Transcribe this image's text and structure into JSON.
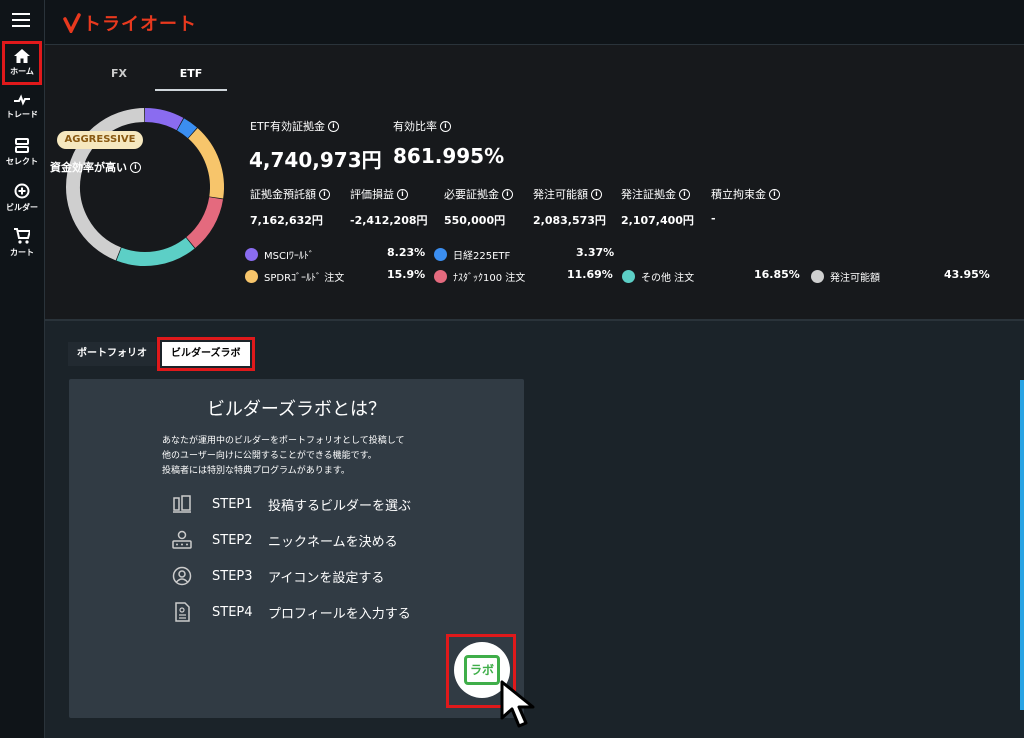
{
  "app": {
    "logo_text": "トライオート",
    "brand_color": "#e8391e"
  },
  "sidebar": {
    "items": [
      {
        "label": "ホーム",
        "icon": "home-icon"
      },
      {
        "label": "トレード",
        "icon": "trade-icon"
      },
      {
        "label": "セレクト",
        "icon": "select-icon"
      },
      {
        "label": "ビルダー",
        "icon": "plus-circle-icon"
      },
      {
        "label": "カート",
        "icon": "cart-icon"
      }
    ]
  },
  "tabs": [
    {
      "label": "FX"
    },
    {
      "label": "ETF"
    }
  ],
  "summary": {
    "badge": "AGGRESSIVE",
    "capital_efficiency": "資金効率が高い",
    "etf_margin_label": "ETF有効証拠金",
    "etf_margin_value": "4,740,973円",
    "ratio_label": "有効比率",
    "ratio_value": "861.995%",
    "metrics": [
      {
        "label": "証拠金預託額",
        "value": "7,162,632円"
      },
      {
        "label": "評価損益",
        "value": "-2,412,208円"
      },
      {
        "label": "必要証拠金",
        "value": "550,000円"
      },
      {
        "label": "発注可能額",
        "value": "2,083,573円"
      },
      {
        "label": "発注証拠金",
        "value": "2,107,400円"
      },
      {
        "label": "積立拘束金",
        "value": "-"
      }
    ]
  },
  "allocation": [
    {
      "name": "MSCIﾜｰﾙﾄﾞ",
      "pct": "8.23%",
      "value": 8.23,
      "color": "#8a6cf0"
    },
    {
      "name": "日経225ETF",
      "pct": "3.37%",
      "value": 3.37,
      "color": "#3b8ef0"
    },
    {
      "name": "SPDRｺﾞｰﾙﾄﾞ 注文",
      "pct": "15.9%",
      "value": 15.9,
      "color": "#f7c56b"
    },
    {
      "name": "ﾅｽﾀﾞｯｸ100 注文",
      "pct": "11.69%",
      "value": 11.69,
      "color": "#e46a7e"
    },
    {
      "name": "その他 注文",
      "pct": "16.85%",
      "value": 16.85,
      "color": "#5ccfc6"
    },
    {
      "name": "発注可能額",
      "pct": "43.95%",
      "value": 43.95,
      "color": "#cfcfcf"
    }
  ],
  "subtabs": [
    {
      "label": "ポートフォリオ"
    },
    {
      "label": "ビルダーズラボ"
    }
  ],
  "card": {
    "title": "ビルダーズラボとは？",
    "desc_lines": [
      "あなたが運用中のビルダーをポートフォリオとして投稿して",
      "他のユーザー向けに公開することができる機能です。",
      "投稿者には特別な特典プログラムがあります。"
    ],
    "steps": [
      {
        "no": "STEP1",
        "text": "投稿するビルダーを選ぶ",
        "icon": "builder-select-icon"
      },
      {
        "no": "STEP2",
        "text": "ニックネームを決める",
        "icon": "nickname-icon"
      },
      {
        "no": "STEP3",
        "text": "アイコンを設定する",
        "icon": "avatar-setting-icon"
      },
      {
        "no": "STEP4",
        "text": "プロフィールを入力する",
        "icon": "profile-doc-icon"
      }
    ],
    "lab_button": "ラボ"
  }
}
